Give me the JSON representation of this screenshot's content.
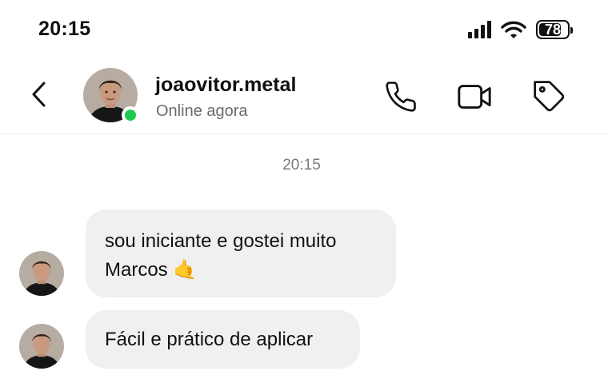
{
  "status_bar": {
    "time": "20:15",
    "battery": "78",
    "battery_level": 0.78
  },
  "header": {
    "contact_name": "joaovitor.metal",
    "contact_status": "Online agora",
    "icons": [
      "chevron-left-icon",
      "phone-icon",
      "video-camera-icon",
      "tag-icon"
    ]
  },
  "chat": {
    "timestamp": "20:15",
    "messages": [
      {
        "text": "sou iniciante e gostei muito",
        "text_line2": "Marcos 🤙"
      },
      {
        "text": "Fácil e prático de aplicar"
      }
    ]
  },
  "colors": {
    "online": "#1ec94f",
    "bubble": "#f0f0f0",
    "secondary_text": "#6b6b6b"
  }
}
